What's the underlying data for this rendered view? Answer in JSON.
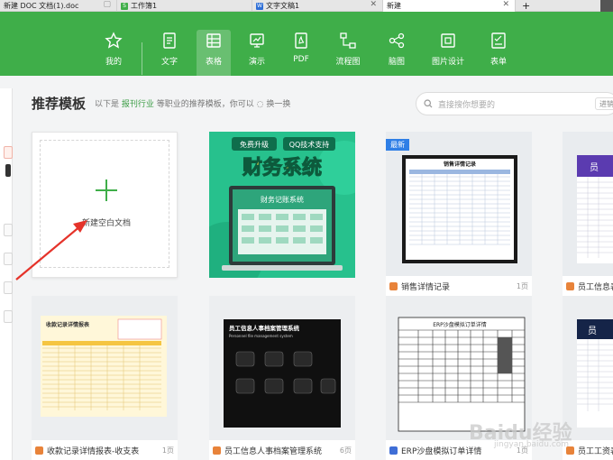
{
  "tabs": [
    {
      "label": "新建 DOC 文档(1).doc",
      "icon": "doc-icon"
    },
    {
      "label": "工作簿1",
      "icon": "sheet-icon"
    },
    {
      "label": "文字文稿1",
      "icon": "doc-icon"
    },
    {
      "label": "新建",
      "icon": "wps-icon"
    }
  ],
  "ribbon": {
    "items": [
      "我的",
      "文字",
      "表格",
      "演示",
      "PDF",
      "流程图",
      "脑图",
      "图片设计",
      "表单"
    ],
    "active": "表格",
    "color": "#3fae49"
  },
  "header": {
    "title": "推荐模板",
    "subtitle_prefix": "以下是",
    "subtitle_link": "报刊行业",
    "subtitle_suffix": "等职业的推荐模板，你可以",
    "refresh": "换一换",
    "search_placeholder": "直接搜你想要的",
    "search_more": "进销"
  },
  "blank": {
    "label": "新建空白文档"
  },
  "cards": [
    {
      "title": "销售详情记录",
      "pages": "1页",
      "badge": "最新",
      "thumb_title": "销售详情记录"
    },
    {
      "title": "员工信息表",
      "pages": "",
      "thumb_title": "员"
    },
    {
      "title": "收款记录详情报表-收支表",
      "pages": "1页",
      "thumb_title": "收款记录详情报表"
    },
    {
      "title": "员工信息人事档案管理系统",
      "pages": "6页",
      "thumb_title": "员工信息人事档案管理系统",
      "thumb_sub": "Personnel file management system"
    },
    {
      "title": "ERP沙盘模拟订单详情",
      "pages": "1页",
      "thumb_title": "ERP沙盘模拟订单详情"
    },
    {
      "title": "员工工资表",
      "pages": "",
      "thumb_title": "员"
    }
  ],
  "featured": {
    "tag1": "免费升级",
    "tag2": "QQ技术支持",
    "title": "财务系统",
    "screen_title": "财务记账系统"
  },
  "watermark": {
    "text": "Baidu经验",
    "url": "jingyan.baidu.com"
  }
}
